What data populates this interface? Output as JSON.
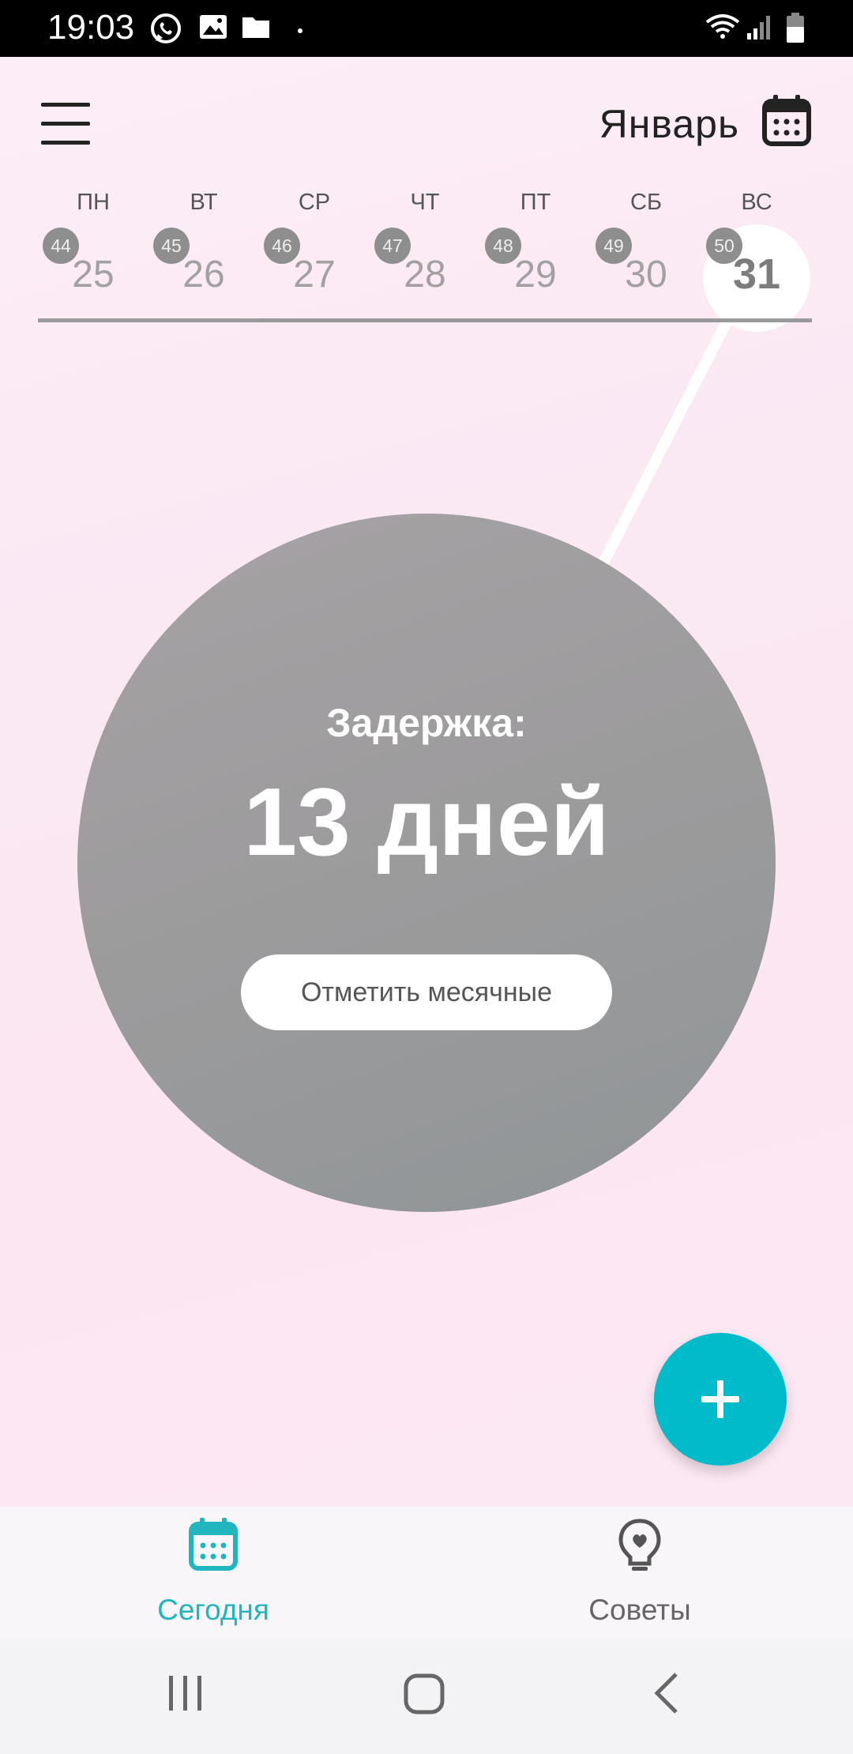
{
  "status_bar": {
    "time": "19:03",
    "icons": [
      "whatsapp-icon",
      "gallery-icon",
      "folder-icon",
      "dot-icon",
      "wifi-icon",
      "signal-icon",
      "battery-icon"
    ]
  },
  "header": {
    "month": "Январь",
    "menu_icon": "hamburger-menu-icon",
    "calendar_icon": "calendar-icon"
  },
  "week": {
    "days": [
      {
        "name": "ПН",
        "week_number": "44",
        "date": "25",
        "today": false
      },
      {
        "name": "ВТ",
        "week_number": "45",
        "date": "26",
        "today": false
      },
      {
        "name": "СР",
        "week_number": "46",
        "date": "27",
        "today": false
      },
      {
        "name": "ЧТ",
        "week_number": "47",
        "date": "28",
        "today": false
      },
      {
        "name": "ПТ",
        "week_number": "48",
        "date": "29",
        "today": false
      },
      {
        "name": "СБ",
        "week_number": "49",
        "date": "30",
        "today": false
      },
      {
        "name": "ВС",
        "week_number": "50",
        "date": "31",
        "today": true
      }
    ]
  },
  "status": {
    "label": "Задержка:",
    "value": "13 дней",
    "button_label": "Отметить месячные"
  },
  "fab": {
    "icon": "plus-icon"
  },
  "bottom_nav": {
    "items": [
      {
        "label": "Сегодня",
        "icon": "calendar-icon",
        "active": true
      },
      {
        "label": "Советы",
        "icon": "lightbulb-heart-icon",
        "active": false
      }
    ]
  },
  "colors": {
    "accent": "#00bcca",
    "active_nav": "#21b5c0",
    "circle": "#9c9b9c",
    "background": "#fbe8f3"
  }
}
